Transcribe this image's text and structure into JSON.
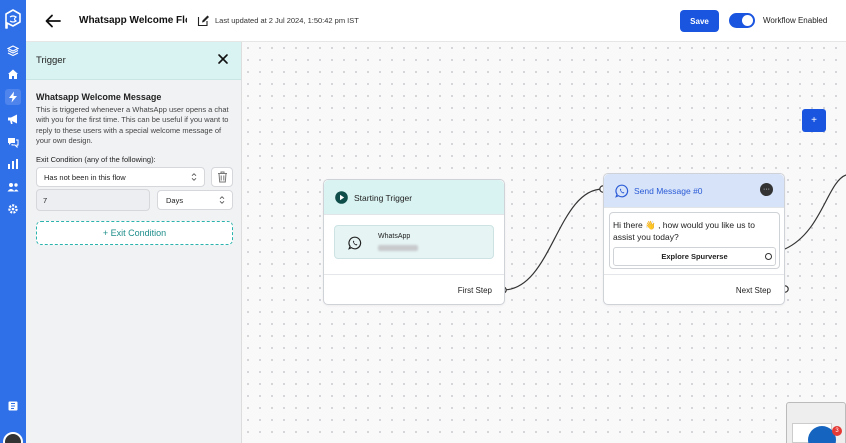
{
  "header": {
    "title": "Whatsapp Welcome Flow",
    "last_updated": "Last updated at 2 Jul 2024, 1:50:42 pm IST",
    "save_label": "Save",
    "workflow_label": "Workflow Enabled",
    "workflow_enabled": true
  },
  "rail": {
    "icons": [
      "logo-icon",
      "box-icon",
      "home-icon",
      "bolt-icon",
      "megaphone-icon",
      "chat-icon",
      "chart-icon",
      "users-icon",
      "settings-icon",
      "book-icon"
    ]
  },
  "panel": {
    "title": "Trigger",
    "trigger_name": "Whatsapp Welcome Message",
    "description": "This is triggered whenever a WhatsApp user opens a chat with you for the first time. This can be useful if you want to reply to these users with a special welcome message of your own design.",
    "exit_label": "Exit Condition (any of the following):",
    "condition_value": "Has not been in this flow",
    "number_value": "7",
    "unit_value": "Days",
    "exit_button": "+ Exit Condition"
  },
  "canvas": {
    "add_label": "+",
    "node1": {
      "title": "Starting Trigger",
      "channel": "WhatsApp",
      "step_label": "First Step"
    },
    "node2": {
      "title": "Send Message #0",
      "message": "Hi there 👋 , how would you like us to assist you today?",
      "quick_reply": "Explore Spurverse",
      "step_label": "Next Step"
    }
  },
  "chat_badge": "3",
  "colors": {
    "primary": "#1a55e0",
    "rail": "#2f6fe8",
    "teal_header": "#d9f3f2",
    "blue_header": "#d7e3f8"
  }
}
